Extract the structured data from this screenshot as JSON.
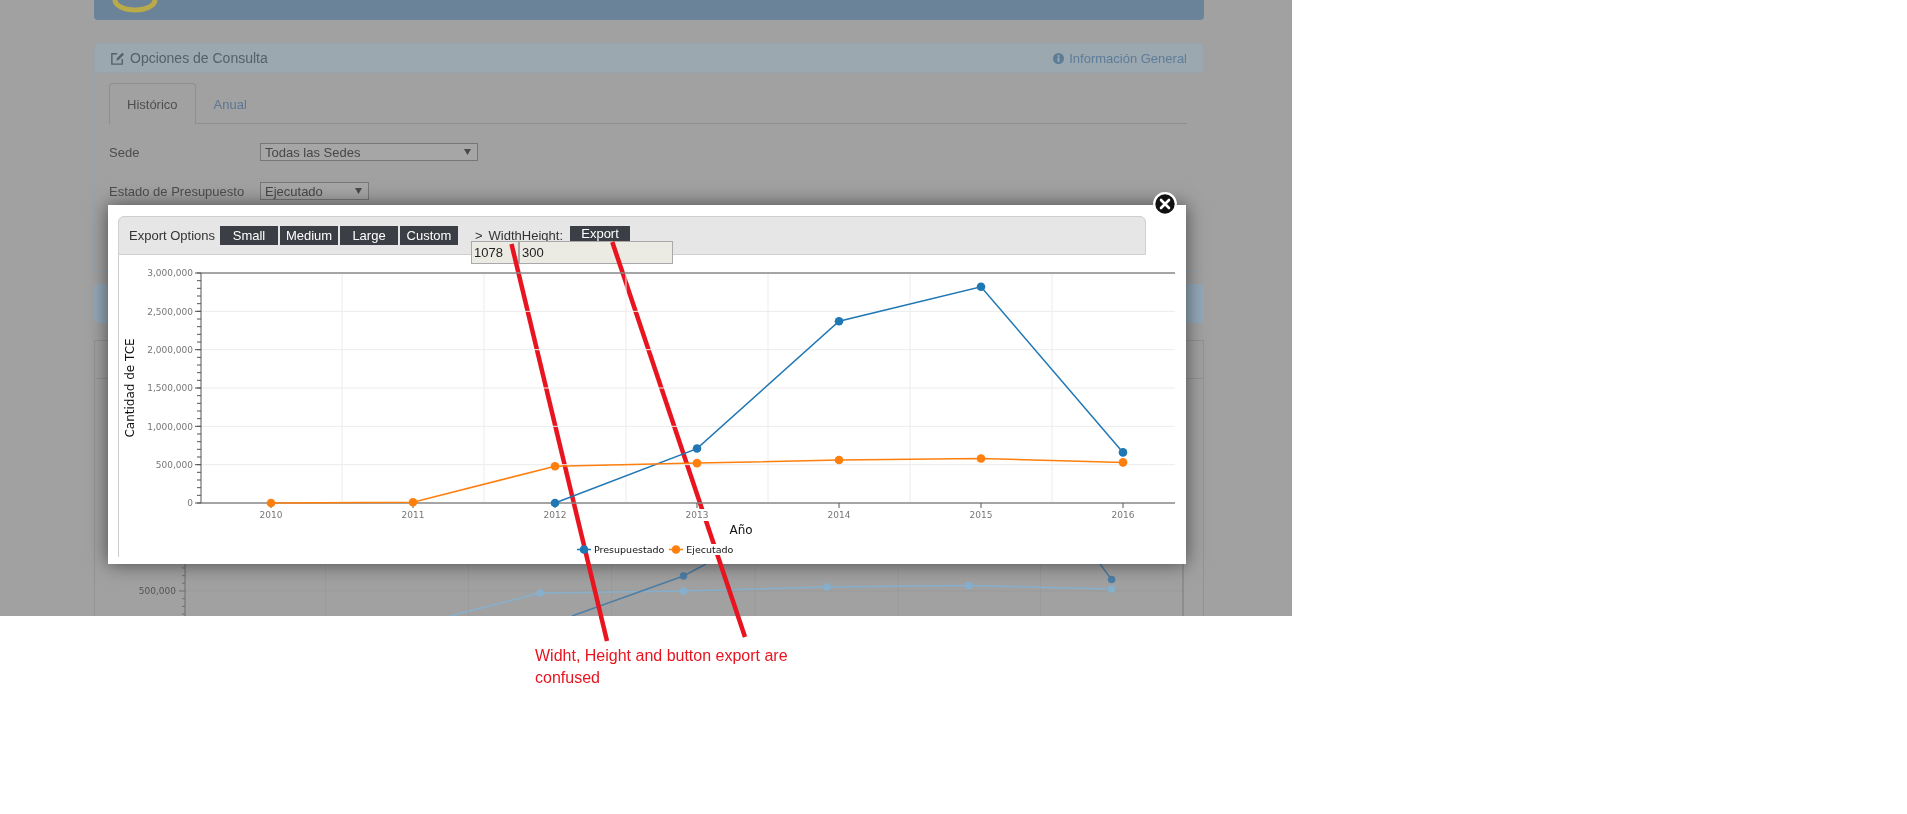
{
  "query_panel": {
    "title": "Opciones de Consulta",
    "info_link": "Información General",
    "tabs": [
      {
        "label": "Histórico",
        "selected": true
      },
      {
        "label": "Anual",
        "selected": false
      }
    ],
    "fields": [
      {
        "label": "Sede",
        "value": "Todas las Sedes"
      },
      {
        "label": "Estado de Presupuesto",
        "value": "Ejecutado"
      }
    ]
  },
  "background_chart": {
    "y_tick": "500,000"
  },
  "export_dialog": {
    "options_label": "Export Options",
    "size_buttons": [
      "Small",
      "Medium",
      "Large",
      "Custom"
    ],
    "toggle": ">",
    "width_label": "Width",
    "height_label": "Height:",
    "export_button": "Export",
    "width_value": "1078",
    "height_value": "300",
    "chart_data": {
      "type": "line",
      "xlabel": "Año",
      "ylabel": "Cantidad de TCE",
      "categories": [
        "2010",
        "2011",
        "2012",
        "2013",
        "2014",
        "2015",
        "2016"
      ],
      "series": [
        {
          "name": "Presupuestado",
          "color": "#1f77b4",
          "marker": "circle",
          "values": [
            null,
            null,
            0,
            710000,
            2370000,
            2820000,
            660000
          ]
        },
        {
          "name": "Ejecutado",
          "color": "#ff7f0e",
          "marker": "circle",
          "values": [
            0,
            10000,
            480000,
            520000,
            560000,
            580000,
            530000
          ]
        }
      ],
      "ylim": [
        0,
        3000000
      ],
      "yticks": [
        {
          "value": 0,
          "label": "0"
        },
        {
          "value": 500000,
          "label": "500,000"
        },
        {
          "value": 1000000,
          "label": "1,000,000"
        },
        {
          "value": 1500000,
          "label": "1,500,000"
        },
        {
          "value": 2000000,
          "label": "2,000,000"
        },
        {
          "value": 2500000,
          "label": "2,500,000"
        },
        {
          "value": 3000000,
          "label": "3,000,000"
        }
      ],
      "grid": true,
      "legend": true
    }
  },
  "annotation": {
    "text": "Widht, Height and button export are confused"
  }
}
